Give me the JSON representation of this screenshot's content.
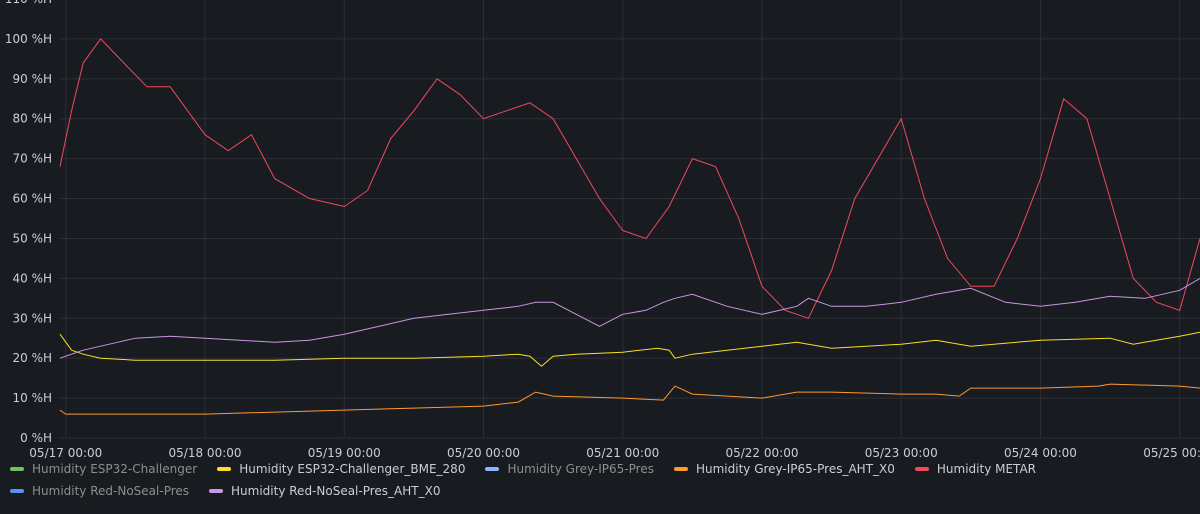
{
  "chart_data": {
    "type": "line",
    "y_unit": "%H",
    "ylim": [
      0,
      110
    ],
    "y_ticks": [
      0,
      10,
      20,
      30,
      40,
      50,
      60,
      70,
      80,
      90,
      100,
      110
    ],
    "y_tick_labels": [
      "0 %H",
      "10 %H",
      "20 %H",
      "30 %H",
      "40 %H",
      "50 %H",
      "60 %H",
      "70 %H",
      "80 %H",
      "90 %H",
      "100 %H",
      "110 %H"
    ],
    "xlim": [
      "2024-05-16 23:00",
      "2024-05-25 03:30"
    ],
    "x_ticks": [
      "2024-05-17 00:00",
      "2024-05-18 00:00",
      "2024-05-19 00:00",
      "2024-05-20 00:00",
      "2024-05-21 00:00",
      "2024-05-22 00:00",
      "2024-05-23 00:00",
      "2024-05-24 00:00",
      "2024-05-25 00:00"
    ],
    "x_tick_labels": [
      "05/17 00:00",
      "05/18 00:00",
      "05/19 00:00",
      "05/20 00:00",
      "05/21 00:00",
      "05/22 00:00",
      "05/23 00:00",
      "05/24 00:00",
      "05/25 00:00"
    ],
    "grid": true,
    "legend_position": "bottom",
    "series": [
      {
        "name": "Humidity ESP32-Challenger",
        "color": "#73bf69",
        "visible": false,
        "x": [],
        "y": []
      },
      {
        "name": "Humidity ESP32-Challenger_BME_280",
        "color": "#fade2a",
        "visible": true,
        "x": [
          "2024-05-16 23:00",
          "2024-05-17 00:00",
          "2024-05-17 01:00",
          "2024-05-17 03:00",
          "2024-05-17 06:00",
          "2024-05-17 12:00",
          "2024-05-18 00:00",
          "2024-05-18 12:00",
          "2024-05-19 00:00",
          "2024-05-19 12:00",
          "2024-05-20 00:00",
          "2024-05-20 06:00",
          "2024-05-20 08:00",
          "2024-05-20 10:00",
          "2024-05-20 12:00",
          "2024-05-20 16:00",
          "2024-05-21 00:00",
          "2024-05-21 06:00",
          "2024-05-21 08:00",
          "2024-05-21 09:00",
          "2024-05-21 12:00",
          "2024-05-22 00:00",
          "2024-05-22 06:00",
          "2024-05-22 12:00",
          "2024-05-23 00:00",
          "2024-05-23 06:00",
          "2024-05-23 12:00",
          "2024-05-24 00:00",
          "2024-05-24 12:00",
          "2024-05-24 16:00",
          "2024-05-25 00:00",
          "2024-05-25 03:30"
        ],
        "y": [
          26,
          24,
          22,
          21,
          20,
          19.5,
          19.5,
          19.5,
          20,
          20,
          20.5,
          21,
          20.5,
          18,
          20.5,
          21,
          21.5,
          22.5,
          22,
          20,
          21,
          23,
          24,
          22.5,
          23.5,
          24.5,
          23,
          24.5,
          25,
          23.5,
          25.5,
          26.5
        ]
      },
      {
        "name": "Humidity Grey-IP65-Pres",
        "color": "#8ab8ff",
        "visible": false,
        "x": [],
        "y": []
      },
      {
        "name": "Humidity Grey-IP65-Pres_AHT_X0",
        "color": "#ff9830",
        "visible": true,
        "x": [
          "2024-05-16 23:00",
          "2024-05-17 00:00",
          "2024-05-17 12:00",
          "2024-05-18 00:00",
          "2024-05-18 12:00",
          "2024-05-19 00:00",
          "2024-05-19 12:00",
          "2024-05-20 00:00",
          "2024-05-20 06:00",
          "2024-05-20 09:00",
          "2024-05-20 12:00",
          "2024-05-21 00:00",
          "2024-05-21 07:00",
          "2024-05-21 09:00",
          "2024-05-21 12:00",
          "2024-05-22 00:00",
          "2024-05-22 06:00",
          "2024-05-22 12:00",
          "2024-05-23 00:00",
          "2024-05-23 06:00",
          "2024-05-23 10:00",
          "2024-05-23 12:00",
          "2024-05-24 00:00",
          "2024-05-24 10:00",
          "2024-05-24 12:00",
          "2024-05-25 00:00",
          "2024-05-25 03:30"
        ],
        "y": [
          7,
          6,
          6,
          6,
          6.5,
          7,
          7.5,
          8,
          9,
          11.5,
          10.5,
          10,
          9.5,
          13,
          11,
          10,
          11.5,
          11.5,
          11,
          11,
          10.5,
          12.5,
          12.5,
          13,
          13.5,
          13,
          12.5
        ]
      },
      {
        "name": "Humidity METAR",
        "color": "#f2495c",
        "visible": true,
        "x": [
          "2024-05-16 23:00",
          "2024-05-17 01:00",
          "2024-05-17 03:00",
          "2024-05-17 06:00",
          "2024-05-17 10:00",
          "2024-05-17 14:00",
          "2024-05-17 18:00",
          "2024-05-18 00:00",
          "2024-05-18 04:00",
          "2024-05-18 08:00",
          "2024-05-18 12:00",
          "2024-05-18 18:00",
          "2024-05-19 00:00",
          "2024-05-19 04:00",
          "2024-05-19 08:00",
          "2024-05-19 12:00",
          "2024-05-19 16:00",
          "2024-05-19 20:00",
          "2024-05-20 00:00",
          "2024-05-20 04:00",
          "2024-05-20 08:00",
          "2024-05-20 12:00",
          "2024-05-20 16:00",
          "2024-05-20 20:00",
          "2024-05-21 00:00",
          "2024-05-21 04:00",
          "2024-05-21 08:00",
          "2024-05-21 12:00",
          "2024-05-21 16:00",
          "2024-05-21 20:00",
          "2024-05-22 00:00",
          "2024-05-22 04:00",
          "2024-05-22 08:00",
          "2024-05-22 12:00",
          "2024-05-22 16:00",
          "2024-05-22 20:00",
          "2024-05-23 00:00",
          "2024-05-23 04:00",
          "2024-05-23 08:00",
          "2024-05-23 12:00",
          "2024-05-23 16:00",
          "2024-05-23 20:00",
          "2024-05-24 00:00",
          "2024-05-24 04:00",
          "2024-05-24 08:00",
          "2024-05-24 12:00",
          "2024-05-24 16:00",
          "2024-05-24 20:00",
          "2024-05-25 00:00",
          "2024-05-25 03:30"
        ],
        "y": [
          68,
          82,
          94,
          100,
          94,
          88,
          88,
          76,
          72,
          76,
          65,
          60,
          58,
          62,
          75,
          82,
          90,
          86,
          80,
          82,
          84,
          80,
          70,
          60,
          52,
          50,
          58,
          70,
          68,
          55,
          38,
          32,
          30,
          42,
          60,
          70,
          80,
          60,
          45,
          38,
          38,
          50,
          65,
          85,
          80,
          60,
          40,
          34,
          32,
          50
        ]
      },
      {
        "name": "Humidity Red-NoSeal-Pres",
        "color": "#5794f2",
        "visible": false,
        "x": [],
        "y": []
      },
      {
        "name": "Humidity Red-NoSeal-Pres_AHT_X0",
        "color": "#ca95e5",
        "visible": true,
        "x": [
          "2024-05-16 23:00",
          "2024-05-17 00:00",
          "2024-05-17 03:00",
          "2024-05-17 06:00",
          "2024-05-17 09:00",
          "2024-05-17 12:00",
          "2024-05-17 18:00",
          "2024-05-18 00:00",
          "2024-05-18 06:00",
          "2024-05-18 12:00",
          "2024-05-18 18:00",
          "2024-05-19 00:00",
          "2024-05-19 06:00",
          "2024-05-19 12:00",
          "2024-05-19 18:00",
          "2024-05-20 00:00",
          "2024-05-20 06:00",
          "2024-05-20 09:00",
          "2024-05-20 12:00",
          "2024-05-20 16:00",
          "2024-05-20 20:00",
          "2024-05-21 00:00",
          "2024-05-21 04:00",
          "2024-05-21 07:00",
          "2024-05-21 09:00",
          "2024-05-21 12:00",
          "2024-05-21 18:00",
          "2024-05-22 00:00",
          "2024-05-22 06:00",
          "2024-05-22 08:00",
          "2024-05-22 12:00",
          "2024-05-22 18:00",
          "2024-05-23 00:00",
          "2024-05-23 06:00",
          "2024-05-23 12:00",
          "2024-05-23 18:00",
          "2024-05-24 00:00",
          "2024-05-24 06:00",
          "2024-05-24 12:00",
          "2024-05-24 18:00",
          "2024-05-25 00:00",
          "2024-05-25 03:30"
        ],
        "y": [
          20,
          20.5,
          22,
          23,
          24,
          25,
          25.5,
          25,
          24.5,
          24,
          24.5,
          26,
          28,
          30,
          31,
          32,
          33,
          34,
          34,
          31,
          28,
          31,
          32,
          34,
          35,
          36,
          33,
          31,
          33,
          35,
          33,
          33,
          34,
          36,
          37.5,
          34,
          33,
          34,
          35.5,
          35,
          37,
          40
        ]
      }
    ]
  }
}
